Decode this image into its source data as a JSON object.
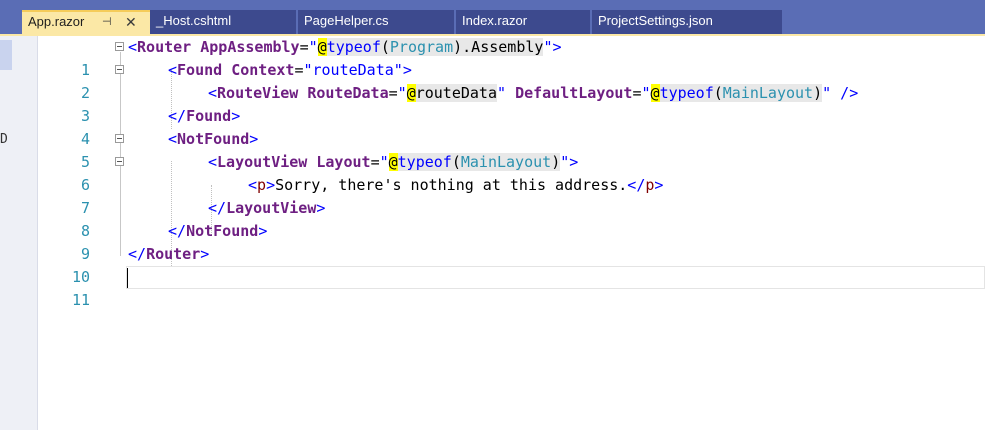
{
  "tabs": [
    {
      "label": "App.razor",
      "active": true,
      "pin_icon": "pin-icon",
      "close_icon": "close-icon"
    },
    {
      "label": "_Host.cshtml"
    },
    {
      "label": "PageHelper.cs"
    },
    {
      "label": "Index.razor"
    },
    {
      "label": "ProjectSettings.json"
    }
  ],
  "left_strip_char": "D",
  "line_numbers": [
    "1",
    "2",
    "3",
    "4",
    "5",
    "6",
    "7",
    "8",
    "9",
    "10",
    "11"
  ],
  "code": {
    "l1": {
      "open": "<",
      "tag": "Router",
      "attr": "AppAssembly",
      "eq": "=",
      "q1": "\"",
      "at": "@",
      "kw": "typeof",
      "p1": "(",
      "type": "Program",
      "p2": ").Assembly",
      "q2": "\"",
      "close": ">"
    },
    "l2": {
      "open": "<",
      "tag": "Found",
      "attr": "Context",
      "eq": "=",
      "str": "\"routeData\"",
      "close": ">"
    },
    "l3": {
      "open": "<",
      "tag": "RouteView",
      "attr1": "RouteData",
      "eq1": "=",
      "q1": "\"",
      "at1": "@",
      "val1": "routeData",
      "q2": "\"",
      "attr2": "DefaultLayout",
      "eq2": "=",
      "q3": "\"",
      "at2": "@",
      "kw": "typeof",
      "p1": "(",
      "type": "MainLayout",
      "p2": ")",
      "q4": "\"",
      "close": " />"
    },
    "l4": {
      "open": "</",
      "tag": "Found",
      "close": ">"
    },
    "l5": {
      "open": "<",
      "tag": "NotFound",
      "close": ">"
    },
    "l6": {
      "open": "<",
      "tag": "LayoutView",
      "attr": "Layout",
      "eq": "=",
      "q1": "\"",
      "at": "@",
      "kw": "typeof",
      "p1": "(",
      "type": "MainLayout",
      "p2": ")",
      "q2": "\"",
      "close": ">"
    },
    "l7": {
      "open": "<",
      "tag": "p",
      "close": ">",
      "text": "Sorry, there's nothing at this address.",
      "endopen": "</",
      "endtag": "p",
      "endclose": ">"
    },
    "l8": {
      "open": "</",
      "tag": "LayoutView",
      "close": ">"
    },
    "l9": {
      "open": "</",
      "tag": "NotFound",
      "close": ">"
    },
    "l10": {
      "open": "</",
      "tag": "Router",
      "close": ">"
    }
  }
}
